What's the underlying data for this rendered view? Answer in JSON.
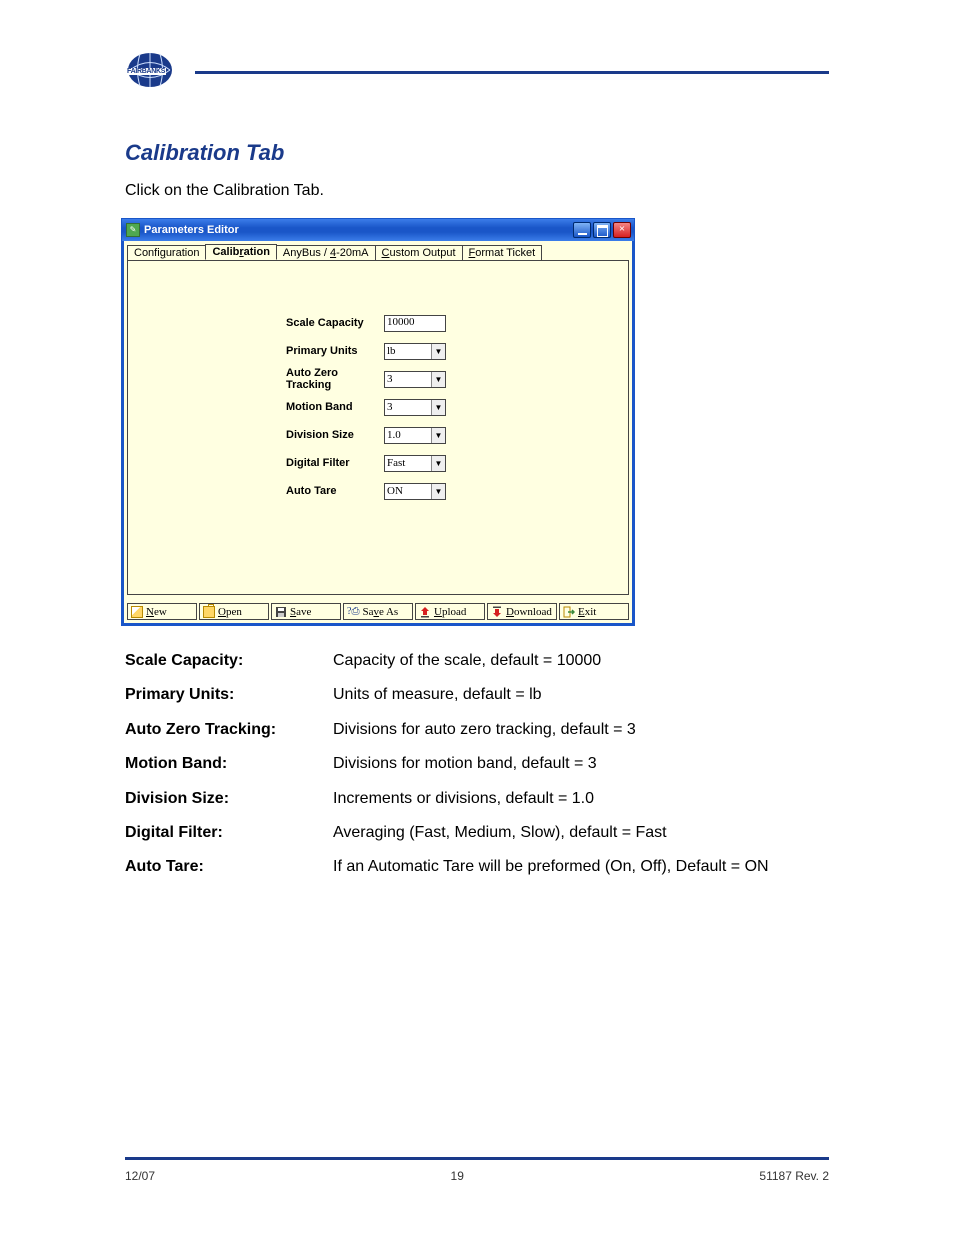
{
  "document": {
    "brand": "FAIRBANKS",
    "sectionTitle": "Calibration Tab",
    "instruction": "Click on the Calibration Tab."
  },
  "window": {
    "title": "Parameters Editor",
    "minLabel": "Minimize",
    "maxLabel": "Maximize",
    "closeLabel": "Close"
  },
  "tabs": [
    {
      "label": "Configuration",
      "accessKey": "g"
    },
    {
      "label": "Calibration",
      "accessKey": "r",
      "active": true
    },
    {
      "label": "AnyBus / 4-20mA",
      "accessKey": "4"
    },
    {
      "label": "Custom Output",
      "accessKey": "C"
    },
    {
      "label": "Format Ticket",
      "accessKey": "F"
    }
  ],
  "fields": {
    "scaleCapacity": {
      "label": "Scale Capacity",
      "value": "10000",
      "type": "text"
    },
    "primaryUnits": {
      "label": "Primary Units",
      "value": "lb",
      "type": "select"
    },
    "autoZeroTracking": {
      "label": "Auto Zero Tracking",
      "value": "3",
      "type": "select"
    },
    "motionBand": {
      "label": "Motion Band",
      "value": "3",
      "type": "select"
    },
    "divisionSize": {
      "label": "Division Size",
      "value": "1.0",
      "type": "select"
    },
    "digitalFilter": {
      "label": "Digital Filter",
      "value": "Fast",
      "type": "select"
    },
    "autoTare": {
      "label": "Auto Tare",
      "value": "ON",
      "type": "select"
    }
  },
  "buttons": {
    "new": "New",
    "open": "Open",
    "save": "Save",
    "saveAs": "Save As",
    "upload": "Upload",
    "download": "Download",
    "exit": "Exit"
  },
  "descriptions": {
    "scaleCapacity": [
      "Scale Capacity:",
      "Capacity of the scale, default = 10000"
    ],
    "primaryUnits": [
      "Primary Units:",
      "Units of measure, default = lb"
    ],
    "autoZeroTracking": [
      "Auto Zero Tracking:",
      "Divisions for auto zero tracking, default = 3"
    ],
    "motionBand": [
      "Motion Band:",
      "Divisions for motion band, default = 3"
    ],
    "divisionSize": [
      "Division Size:",
      "Increments or divisions, default = 1.0"
    ],
    "digitalFilter": [
      "Digital Filter:",
      "Averaging (Fast, Medium, Slow), default = Fast"
    ],
    "autoTare": [
      "Auto Tare:",
      "If an Automatic Tare will be preformed (On, Off), Default = ON"
    ]
  },
  "footer": {
    "left": "12/07",
    "center": "19",
    "right": "51187 Rev. 2"
  }
}
